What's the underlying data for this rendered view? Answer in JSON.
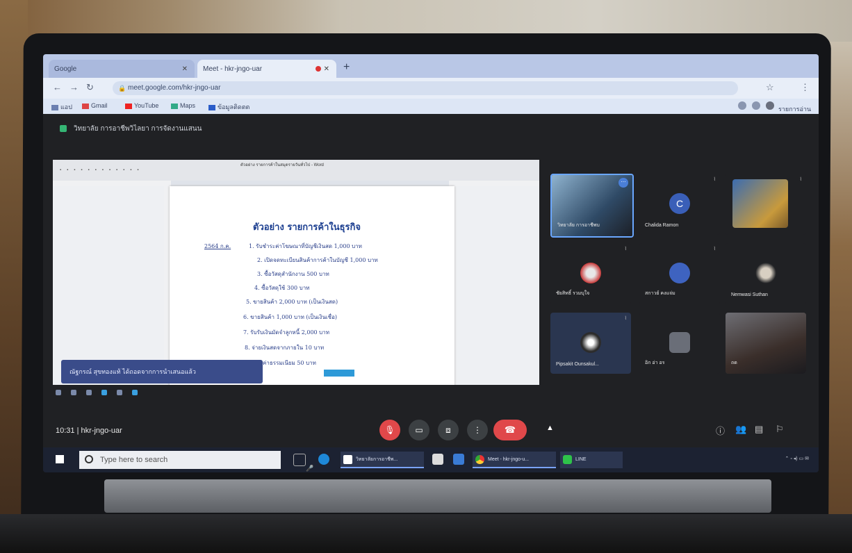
{
  "browser": {
    "tabs": [
      {
        "label": "Google"
      },
      {
        "label": "Meet - hkr-jngo-uar"
      }
    ],
    "new_tab": "+",
    "url": "meet.google.com/hkr-jngo-uar",
    "bookmarks": [
      "แอป",
      "Gmail",
      "YouTube",
      "Maps",
      "ข้อมูลติดตต"
    ],
    "side_label": "รายการอ่าน"
  },
  "meet": {
    "presenter_banner": "วิทยาลัย การอาชีพวิไลยา การจัดงานแสนน",
    "meeting_code": "hkr-jngo-uar",
    "time": "10:31",
    "separator": "|",
    "caption": "ณัฐกรณ์ สุขทองแท้ ได้ถอดจากการนำเสนอแล้ว",
    "participants": [
      {
        "name": "วิทยาลัย การอาชีพบ",
        "initial": ""
      },
      {
        "name": "Chalida Ramon",
        "initial": "C"
      },
      {
        "name": "",
        "initial": ""
      },
      {
        "name": "ชัยสิทธิ์ รวมบุใจ",
        "initial": ""
      },
      {
        "name": "สกาวย์ คงแจ่ม",
        "initial": ""
      },
      {
        "name": "Nemwasi Suthan",
        "initial": ""
      },
      {
        "name": "Pipsakit Ounsakul...",
        "initial": ""
      },
      {
        "name": "อิก อ่า อร",
        "initial": ""
      },
      {
        "name": "ถด",
        "initial": ""
      }
    ]
  },
  "document": {
    "window_title": "ตัวอย่าง รายการค้าในสมุดรายวันทั่วไป - Word",
    "heading": "ตัวอย่าง รายการค้าในธุรกิจ",
    "date": "2564 ก.ค.",
    "lines": [
      "1. รับชำระค่าโฆษณาที่บัญชีเงินสด 1,000 บาท",
      "2. เปิดจดทะเบียนสินค้าการค้าในบัญชี 1,000 บาท",
      "3. ซื้อวัสดุสำนักงาน 500 บาท",
      "4. ซื้อวัสดุใช้ 300 บาท",
      "5. ขายสินค้า 2,000 บาท (เป็นเงินสด)",
      "6. ขายสินค้า 1,000 บาท (เป็นเงินเชื่อ)",
      "7. รับรับเงินมัดจำลูกหนี้ 2,000 บาท",
      "8. จ่ายเงินสดจากภายใน 10 บาท",
      "9. จ่ายค่าธรรมเนียม 50 บาท"
    ]
  },
  "taskbar": {
    "search_placeholder": "Type here to search",
    "apps": [
      "วิทยาลัยการอาชีพ...",
      "Meet - hkr-jngo-u...",
      "LINE"
    ]
  },
  "colors": {
    "meet_bg": "#202124",
    "end_call": "#e0484a",
    "doc_text": "#2a3f8a",
    "caption_bg": "#3a4c8a"
  }
}
